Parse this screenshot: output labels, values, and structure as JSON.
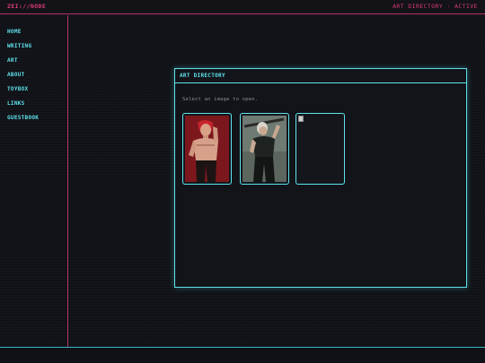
{
  "header": {
    "brand": "ZEI://NODE",
    "status": "ART DIRECTORY · ACTIVE"
  },
  "sidebar": {
    "items": [
      {
        "label": "HOME"
      },
      {
        "label": "WRITING"
      },
      {
        "label": "ART"
      },
      {
        "label": "ABOUT"
      },
      {
        "label": "TOYBOX"
      },
      {
        "label": "LINKS"
      },
      {
        "label": "GUESTBOOK"
      }
    ]
  },
  "window": {
    "title": "ART DIRECTORY",
    "hint": "Select an image to open.",
    "thumbnails": [
      {
        "icon": "art-thumbnail-red"
      },
      {
        "icon": "art-thumbnail-grey"
      },
      {
        "icon": "broken-image-icon"
      }
    ]
  },
  "colors": {
    "accent_cyan": "#5fe3ee",
    "accent_pink": "#d83a78",
    "background": "#101217"
  }
}
